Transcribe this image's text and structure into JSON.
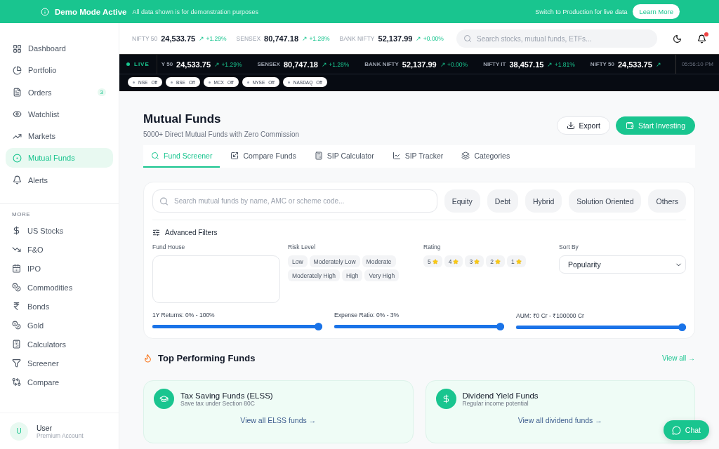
{
  "banner": {
    "title": "Demo Mode Active",
    "message": "All data shown is for demonstration purposes",
    "note": "Switch to Production for live data",
    "button": "Learn More"
  },
  "sidebar": {
    "items": [
      {
        "label": "Dashboard",
        "selected": false
      },
      {
        "label": "Portfolio",
        "selected": false
      },
      {
        "label": "Orders",
        "selected": false,
        "badge": "3"
      },
      {
        "label": "Watchlist",
        "selected": false
      },
      {
        "label": "Markets",
        "selected": false
      },
      {
        "label": "Mutual Funds",
        "selected": true
      },
      {
        "label": "Alerts",
        "selected": false
      }
    ],
    "more_heading": "MORE",
    "more_items": [
      {
        "label": "US Stocks"
      },
      {
        "label": "F&O"
      },
      {
        "label": "IPO"
      },
      {
        "label": "Commodities"
      },
      {
        "label": "Bonds"
      },
      {
        "label": "Gold"
      },
      {
        "label": "Calculators"
      },
      {
        "label": "Screener"
      },
      {
        "label": "Compare"
      }
    ],
    "user": {
      "initial": "U",
      "name": "User",
      "plan": "Premium Account"
    }
  },
  "header": {
    "indices": [
      {
        "name": "NIFTY 50",
        "value": "24,533.75",
        "change": "↗ +1.29%"
      },
      {
        "name": "SENSEX",
        "value": "80,747.18",
        "change": "↗ +1.28%"
      },
      {
        "name": "BANK NIFTY",
        "value": "52,137.99",
        "change": "↗ +0.00%"
      }
    ],
    "search": {
      "placeholder": "Search stocks, mutual funds, ETFs..."
    }
  },
  "ticker": {
    "live": "LIVE",
    "items": [
      {
        "name": "Y 50",
        "value": "24,533.75",
        "change": "↗ +1.29%"
      },
      {
        "name": "SENSEX",
        "value": "80,747.18",
        "change": "↗ +1.28%"
      },
      {
        "name": "BANK NIFTY",
        "value": "52,137.99",
        "change": "↗ +0.00%"
      },
      {
        "name": "NIFTY IT",
        "value": "38,457.15",
        "change": "↗ +1.81%"
      },
      {
        "name": "NIFTY 50",
        "value": "24,533.75",
        "change": "↗"
      }
    ],
    "time": "05:56:10 PM",
    "exchanges": [
      {
        "name": "NSE",
        "status": "Off"
      },
      {
        "name": "BSE",
        "status": "Off"
      },
      {
        "name": "MCX",
        "status": "Off"
      },
      {
        "name": "NYSE",
        "status": "Off"
      },
      {
        "name": "NASDAQ",
        "status": "Off"
      }
    ]
  },
  "page": {
    "title": "Mutual Funds",
    "subtitle": "5000+ Direct Mutual Funds with Zero Commission",
    "buttons": [
      {
        "label": "Export",
        "kind": "outline"
      },
      {
        "label": "Start Investing",
        "kind": "primary"
      }
    ]
  },
  "tabs": [
    {
      "label": "Fund Screener",
      "selected": true
    },
    {
      "label": "Compare Funds",
      "selected": false
    },
    {
      "label": "SIP Calculator",
      "selected": false
    },
    {
      "label": "SIP Tracker",
      "selected": false
    },
    {
      "label": "Categories",
      "selected": false
    }
  ],
  "filters": {
    "search": {
      "placeholder": "Search mutual funds by name, AMC or scheme code..."
    },
    "categories": [
      "Equity",
      "Debt",
      "Hybrid",
      "Solution Oriented",
      "Others"
    ],
    "advanced_title": "Advanced Filters",
    "fund_house": {
      "label": "Fund House"
    },
    "risk": {
      "label": "Risk Level",
      "options": [
        "Low",
        "Moderately Low",
        "Moderate",
        "Moderately High",
        "High",
        "Very High"
      ]
    },
    "rating": {
      "label": "Rating",
      "options": [
        "5",
        "4",
        "3",
        "2",
        "1"
      ]
    },
    "sort": {
      "label": "Sort By",
      "value": "Popularity"
    },
    "ranges": [
      {
        "label": "1Y Returns: 0% - 100%",
        "level": 1
      },
      {
        "label": "Expense Ratio: 0% - 3%",
        "level": 1
      },
      {
        "label": "AUM: ₹0 Cr - ₹100000 Cr",
        "level": 1
      }
    ]
  },
  "top": {
    "title": "Top Performing Funds",
    "link": "View all →",
    "cards": [
      {
        "title": "Tax Saving Funds (ELSS)",
        "subtitle": "Save tax under Section 80C",
        "link": "View all ELSS funds →"
      },
      {
        "title": "Dividend Yield Funds",
        "subtitle": "Regular income potential",
        "link": "View all dividend funds →"
      }
    ]
  },
  "chat": {
    "label": "Chat"
  }
}
